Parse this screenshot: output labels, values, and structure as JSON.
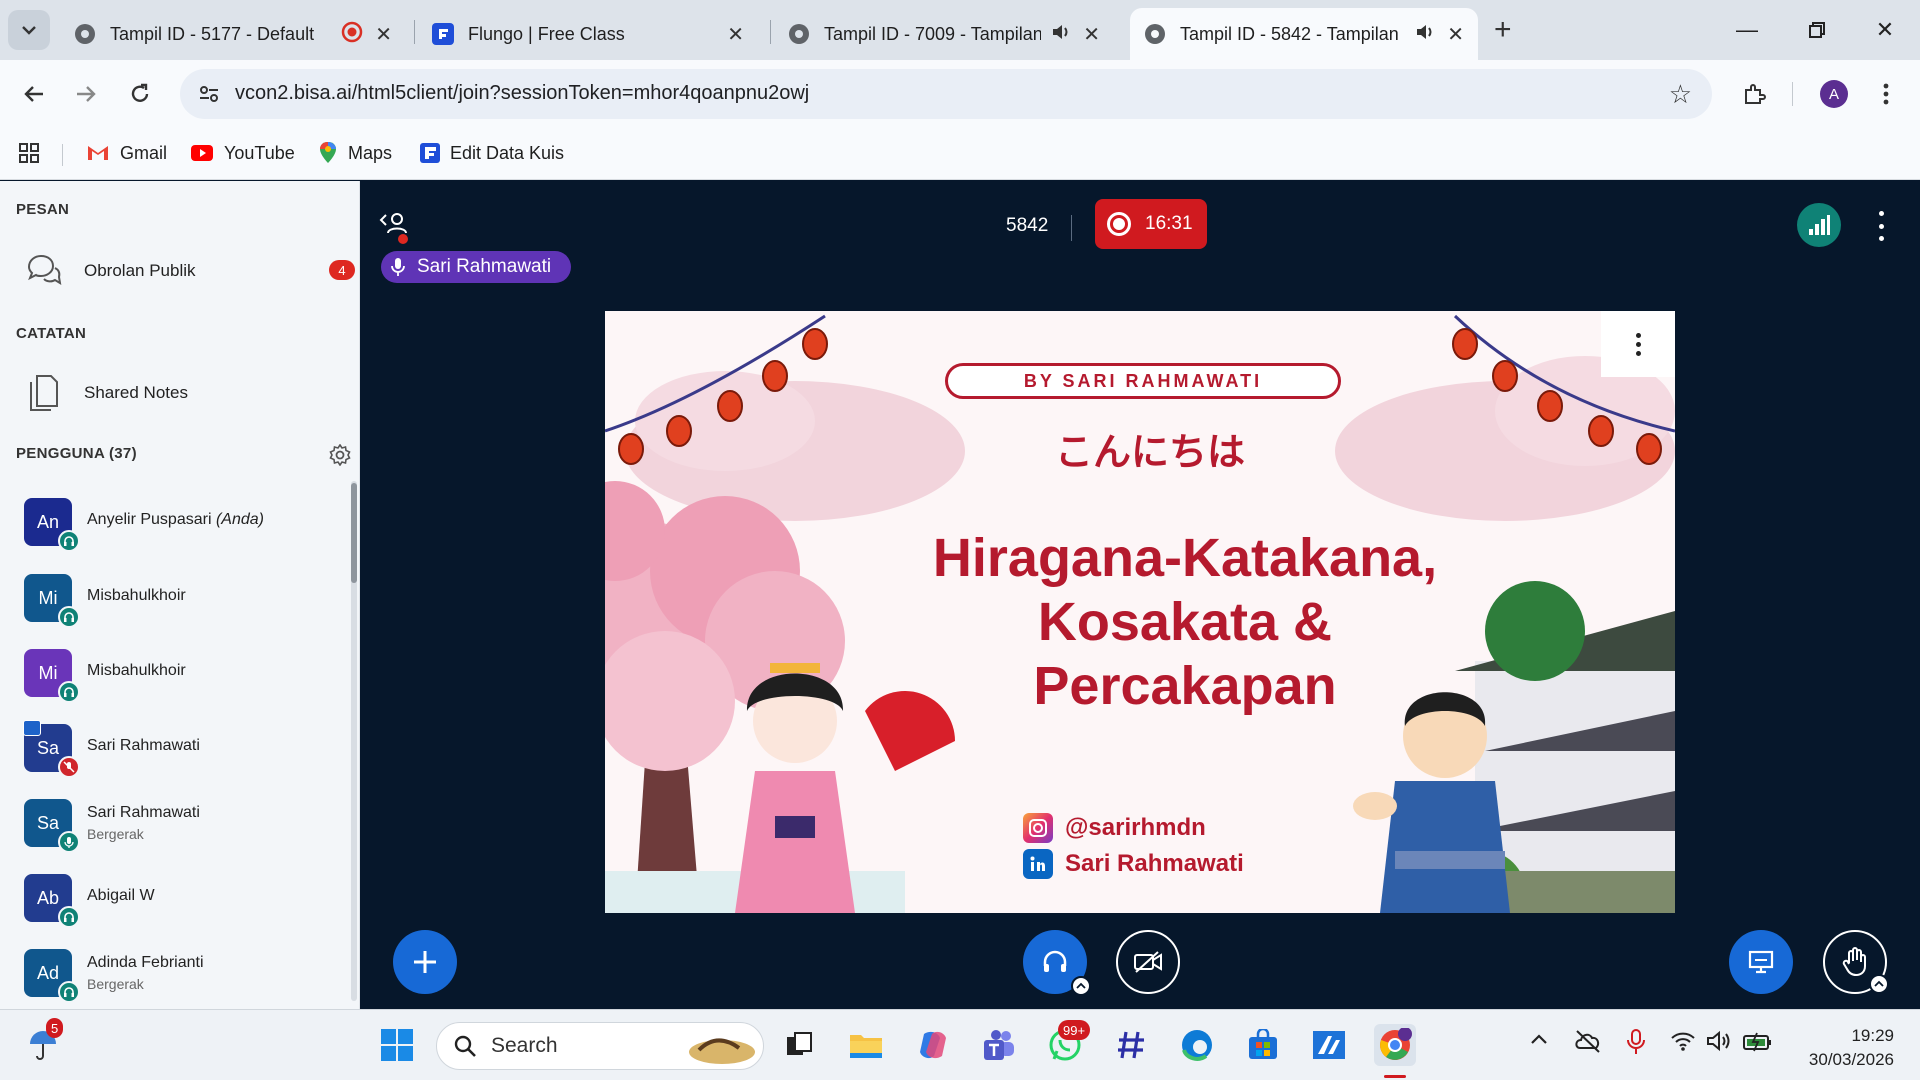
{
  "browser": {
    "tabs": [
      {
        "title": "Tampil ID - 5177 - Default",
        "recording": true
      },
      {
        "title": "Flungo | Free Class"
      },
      {
        "title": "Tampil ID - 7009 - Tampilan",
        "audio": true
      },
      {
        "title": "Tampil ID - 5842 - Tampilan",
        "audio": true,
        "active": true
      }
    ],
    "url": "vcon2.bisa.ai/html5client/join?sessionToken=mhor4qoanpnu2owj",
    "profile_initial": "A",
    "bookmarks": [
      "Gmail",
      "YouTube",
      "Maps",
      "Edit Data Kuis"
    ]
  },
  "sidebar": {
    "messages_title": "PESAN",
    "public_chat": "Obrolan Publik",
    "public_chat_unread": "4",
    "notes_title": "CATATAN",
    "shared_notes": "Shared Notes",
    "users_title": "PENGGUNA (37)",
    "users": [
      {
        "initials": "An",
        "name": "Anyelir Puspasari",
        "you": "(Anda)",
        "color": "#1b2a8f",
        "status": "listen"
      },
      {
        "initials": "Mi",
        "name": "Misbahulkhoir",
        "color": "#10578d",
        "status": "listen"
      },
      {
        "initials": "Mi",
        "name": "Misbahulkhoir",
        "color": "#6a35b9",
        "status": "listen"
      },
      {
        "initials": "Sa",
        "name": "Sari Rahmawati",
        "color": "#223c8f",
        "status": "muted",
        "presenter": true
      },
      {
        "initials": "Sa",
        "name": "Sari Rahmawati",
        "sub": "Bergerak",
        "color": "#10578d",
        "status": "mic"
      },
      {
        "initials": "Ab",
        "name": "Abigail W",
        "color": "#223c8f",
        "status": "listen"
      },
      {
        "initials": "Ad",
        "name": "Adinda Febrianti",
        "sub": "Bergerak",
        "color": "#10578d",
        "status": "listen"
      }
    ]
  },
  "meeting": {
    "session_id": "5842",
    "record_time": "16:31",
    "talking": "Sari Rahmawati"
  },
  "slide": {
    "by_line": "BY SARI RAHMAWATI",
    "greeting": "こんにちは",
    "title_line1": "Hiragana-Katakana,",
    "title_line2": "Kosakata &",
    "title_line3": "Percakapan",
    "instagram": "@sarirhmdn",
    "linkedin": "Sari Rahmawati"
  },
  "taskbar": {
    "weather_badge": "5",
    "search_placeholder": "Search",
    "whatsapp_badge": "99+",
    "time": "19:29",
    "date": "30/03/2026"
  }
}
